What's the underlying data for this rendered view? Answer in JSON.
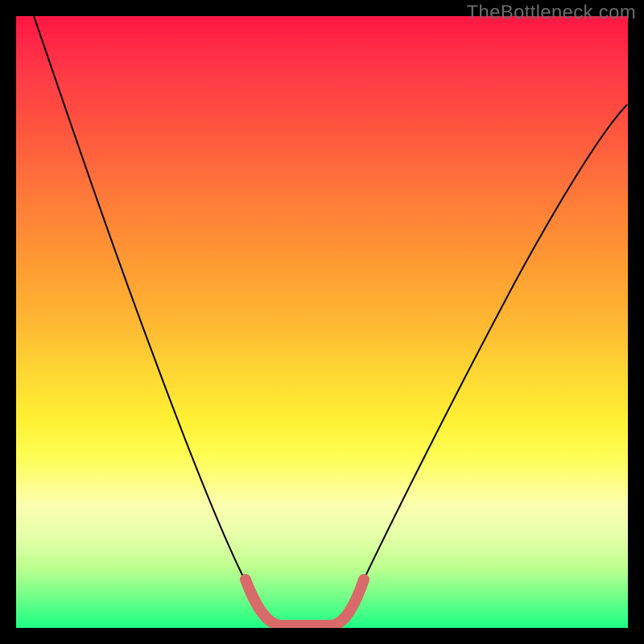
{
  "watermark": "TheBottleneck.com",
  "chart_data": {
    "type": "line",
    "title": "",
    "xlabel": "",
    "ylabel": "",
    "xlim": [
      0,
      100
    ],
    "ylim": [
      0,
      100
    ],
    "background_gradient_meaning": "vertical performance-match scale (red=bad, green=good)",
    "series": [
      {
        "name": "bottleneck-curve",
        "stroke": "#000000",
        "stroke_width": 2,
        "x": [
          3,
          10,
          18,
          25,
          32,
          38,
          41,
          43,
          51,
          53,
          56,
          62,
          70,
          80,
          90,
          99
        ],
        "values": [
          100,
          82,
          63,
          44,
          26,
          10,
          3,
          0,
          0,
          3,
          10,
          23,
          40,
          57,
          72,
          85
        ]
      },
      {
        "name": "highlight-region",
        "stroke": "#d96a6a",
        "stroke_width": 12,
        "x": [
          38,
          41,
          43,
          51,
          53,
          56
        ],
        "values": [
          10,
          3,
          0,
          0,
          3,
          10
        ]
      }
    ]
  }
}
